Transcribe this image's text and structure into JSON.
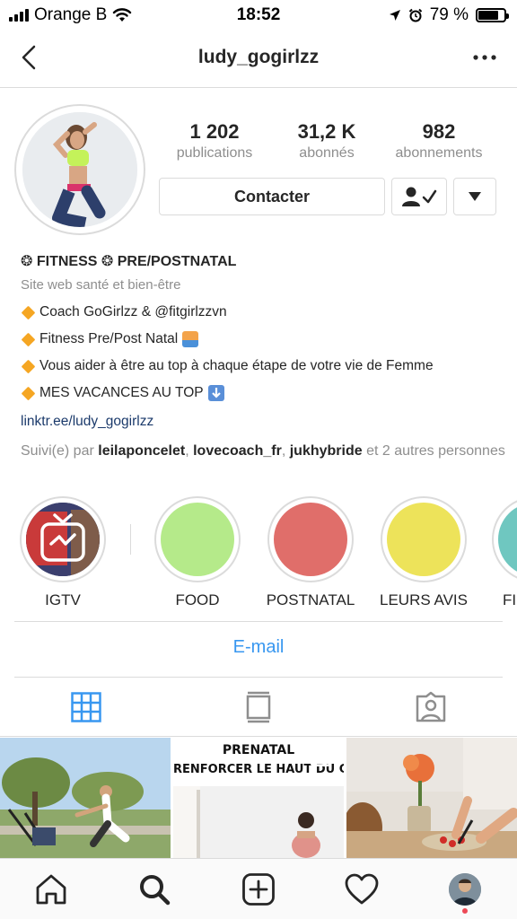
{
  "status_bar": {
    "carrier": "Orange B",
    "time": "18:52",
    "battery": "79 %",
    "battery_level": 0.79,
    "icons": [
      "signal-icon",
      "wifi-icon",
      "location-arrow-icon",
      "alarm-icon",
      "battery-icon"
    ]
  },
  "header": {
    "username": "ludy_gogirlzz",
    "back_icon": "chevron-left-icon",
    "more_icon": "more-dots-icon"
  },
  "stats": [
    {
      "value": "1 202",
      "label": "publications"
    },
    {
      "value": "31,2 K",
      "label": "abonnés"
    },
    {
      "value": "982",
      "label": "abonnements"
    }
  ],
  "actions": {
    "contact_label": "Contacter",
    "following_icon": "person-check-icon",
    "dropdown_icon": "caret-down-icon"
  },
  "bio": {
    "name": "❂ FITNESS ❂ PRE/POSTNATAL",
    "category": "Site web santé et bien-être",
    "lines": [
      "Coach GoGirlzz & @fitgirlzzvn",
      "Fitness Pre/Post Natal",
      "Vous aider à être au top à chaque étape de votre vie de Femme",
      "MES VACANCES AU TOP"
    ],
    "link": "linktr.ee/ludy_gogirlzz",
    "followed_prefix": "Suivi(e) par",
    "followed_users": [
      "leilaponcelet",
      "lovecoach_fr",
      "jukhybride"
    ],
    "followed_suffix": "et 2 autres personnes",
    "sep_comma": ","
  },
  "highlights": [
    {
      "label": "IGTV",
      "icon": "igtv-icon"
    },
    {
      "label": "FOOD",
      "color": "#b5ea8a"
    },
    {
      "label": "POSTNATAL",
      "color": "#e06e6a"
    },
    {
      "label": "LEURS AVIS",
      "color": "#ede35a"
    },
    {
      "label": "FI",
      "color": "#6fc7c0"
    }
  ],
  "email_label": "E-mail",
  "tabs": [
    {
      "icon": "grid-icon",
      "active": true
    },
    {
      "icon": "feed-list-icon",
      "active": false
    },
    {
      "icon": "tagged-person-icon",
      "active": false
    }
  ],
  "posts": [
    {
      "alt": "outdoor-workout-photo"
    },
    {
      "title": "PRENATAL",
      "subtitle": "RENFORCER LE HAUT DU CORPS",
      "icon": "multi-post-icon"
    },
    {
      "alt": "food-prep-photo"
    }
  ],
  "bottom_nav": [
    "home-icon",
    "search-icon",
    "new-post-icon",
    "activity-heart-icon",
    "profile-avatar-icon"
  ],
  "colors": {
    "link_blue": "#3897f0",
    "bio_link": "#1b3a6b",
    "divider": "#dbdbdb",
    "muted": "#8e8e8e"
  }
}
